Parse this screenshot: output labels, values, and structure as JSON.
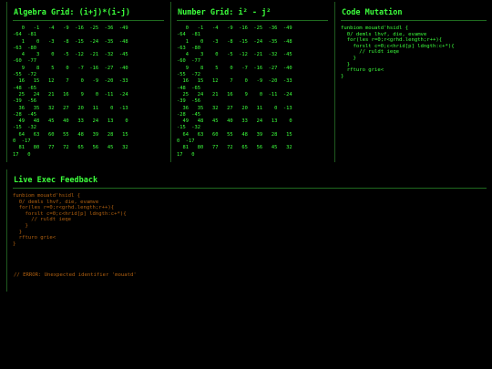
{
  "panels": {
    "algebra": {
      "title": "Algebra Grid: (i+j)*(i-j)",
      "rows": [
        "   0   -1   -4   -9  -16  -25  -36  -49",
        "-64  -81",
        "   1    0   -3   -8  -15  -24  -35  -48",
        "-63  -80",
        "   4    3    0   -5  -12  -21  -32  -45",
        "-60  -77",
        "   9    8    5    0   -7  -16  -27  -40",
        "-55  -72",
        "  16   15   12    7    0   -9  -20  -33",
        "-48  -65",
        "  25   24   21   16    9    0  -11  -24",
        "-39  -56",
        "  36   35   32   27   20   11    0  -13",
        "-28  -45",
        "  49   48   45   40   33   24   13    0",
        "-15  -32",
        "  64   63   60   55   48   39   28   15",
        "0  -17",
        "  81   80   77   72   65   56   45   32",
        "17   0"
      ]
    },
    "number": {
      "title": "Number Grid: i² - j²",
      "rows": [
        "   0   -1   -4   -9  -16  -25  -36  -49",
        "-64  -81",
        "   1    0   -3   -8  -15  -24  -35  -48",
        "-63  -80",
        "   4    3    0   -5  -12  -21  -32  -45",
        "-60  -77",
        "   9    8    5    0   -7  -16  -27  -40",
        "-55  -72",
        "  16   15   12    7    0   -9  -20  -33",
        "-48  -65",
        "  25   24   21   16    9    0  -11  -24",
        "-39  -56",
        "  36   35   32   27   20   11    0  -13",
        "-28  -45",
        "  49   48   45   40   33   24   13    0",
        "-15  -32",
        "  64   63   60   55   48   39   28   15",
        "0  -17",
        "  81   80   77   72   65   56   45   32",
        "17   0"
      ]
    },
    "mutation": {
      "title": "Code Mutation",
      "lines": [
        "funbiom mouatd'hsidl {",
        "  0/ demls lhvf, die, evamve",
        "  for(les r=0;r<grhd.length;r++){",
        "    forslt c=0;c<hrid[p] ldngth:c+*){",
        "      // ruldt ieqe",
        "    }",
        "  }",
        "  rfturo grie<",
        "}"
      ]
    },
    "feedback": {
      "title": "Live Exec Feedback",
      "lines": [
        "funbiom mouatd'hsidl {",
        "  0/ demls lhvf, die, evamve",
        "  for(les r=0;r<grhd.length;r++){",
        "    forslt c=0;c<hrid[p] ldngth:c+*){",
        "      // ruldt ieqe",
        "    }",
        "  }",
        "  rfturo grie<",
        "}"
      ],
      "error": "// ERROR: Unexpected identifier 'mouatd'"
    }
  }
}
